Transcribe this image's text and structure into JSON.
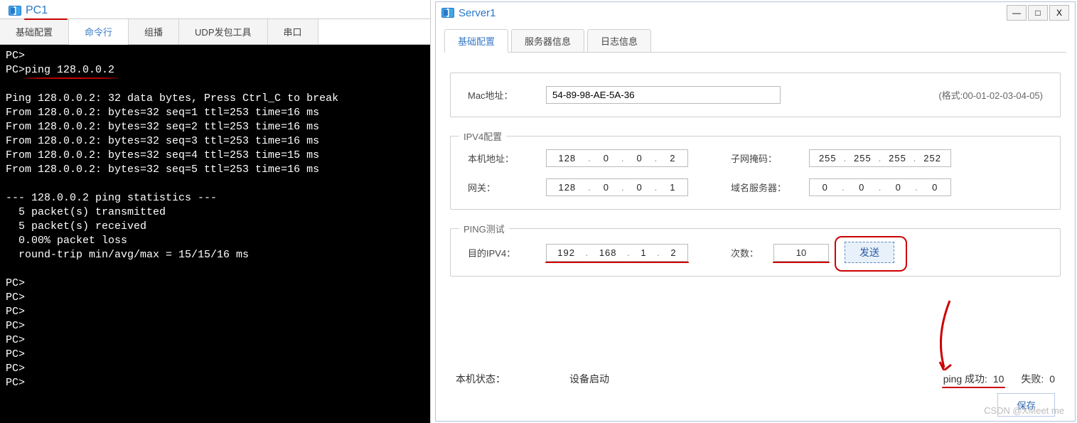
{
  "pc1": {
    "title": "PC1",
    "tabs": [
      "基础配置",
      "命令行",
      "组播",
      "UDP发包工具",
      "串口"
    ],
    "active_tab_index": 1,
    "terminal_lines": [
      "PC>",
      "PC>ping 128.0.0.2",
      "",
      "Ping 128.0.0.2: 32 data bytes, Press Ctrl_C to break",
      "From 128.0.0.2: bytes=32 seq=1 ttl=253 time=16 ms",
      "From 128.0.0.2: bytes=32 seq=2 ttl=253 time=16 ms",
      "From 128.0.0.2: bytes=32 seq=3 ttl=253 time=16 ms",
      "From 128.0.0.2: bytes=32 seq=4 ttl=253 time=15 ms",
      "From 128.0.0.2: bytes=32 seq=5 ttl=253 time=16 ms",
      "",
      "--- 128.0.0.2 ping statistics ---",
      "  5 packet(s) transmitted",
      "  5 packet(s) received",
      "  0.00% packet loss",
      "  round-trip min/avg/max = 15/15/16 ms",
      "",
      "PC>",
      "PC>",
      "PC>",
      "PC>",
      "PC>",
      "PC>",
      "PC>",
      "PC>"
    ]
  },
  "server1": {
    "title": "Server1",
    "tabs": [
      "基础配置",
      "服务器信息",
      "日志信息"
    ],
    "active_tab_index": 0,
    "mac": {
      "label": "Mac地址：",
      "value": "54-89-98-AE-5A-36",
      "hint": "(格式:00-01-02-03-04-05)"
    },
    "ipv4": {
      "legend": "IPV4配置",
      "local_label": "本机地址：",
      "local_ip": [
        "128",
        "0",
        "0",
        "2"
      ],
      "mask_label": "子网掩码：",
      "mask_ip": [
        "255",
        "255",
        "255",
        "252"
      ],
      "gw_label": "网关：",
      "gw_ip": [
        "128",
        "0",
        "0",
        "1"
      ],
      "dns_label": "域名服务器：",
      "dns_ip": [
        "0",
        "0",
        "0",
        "0"
      ]
    },
    "ping": {
      "legend": "PING测试",
      "dest_label": "目的IPV4：",
      "dest_ip": [
        "192",
        "168",
        "1",
        "2"
      ],
      "count_label": "次数：",
      "count": "10",
      "send_label": "发送"
    },
    "status": {
      "host_label": "本机状态：",
      "device": "设备启动",
      "ping_ok_label": "ping 成功:",
      "ping_ok": "10",
      "ping_fail_label": "失败:",
      "ping_fail": "0"
    },
    "save_label": "保存"
  },
  "watermark": "CSDN @XMeet me"
}
